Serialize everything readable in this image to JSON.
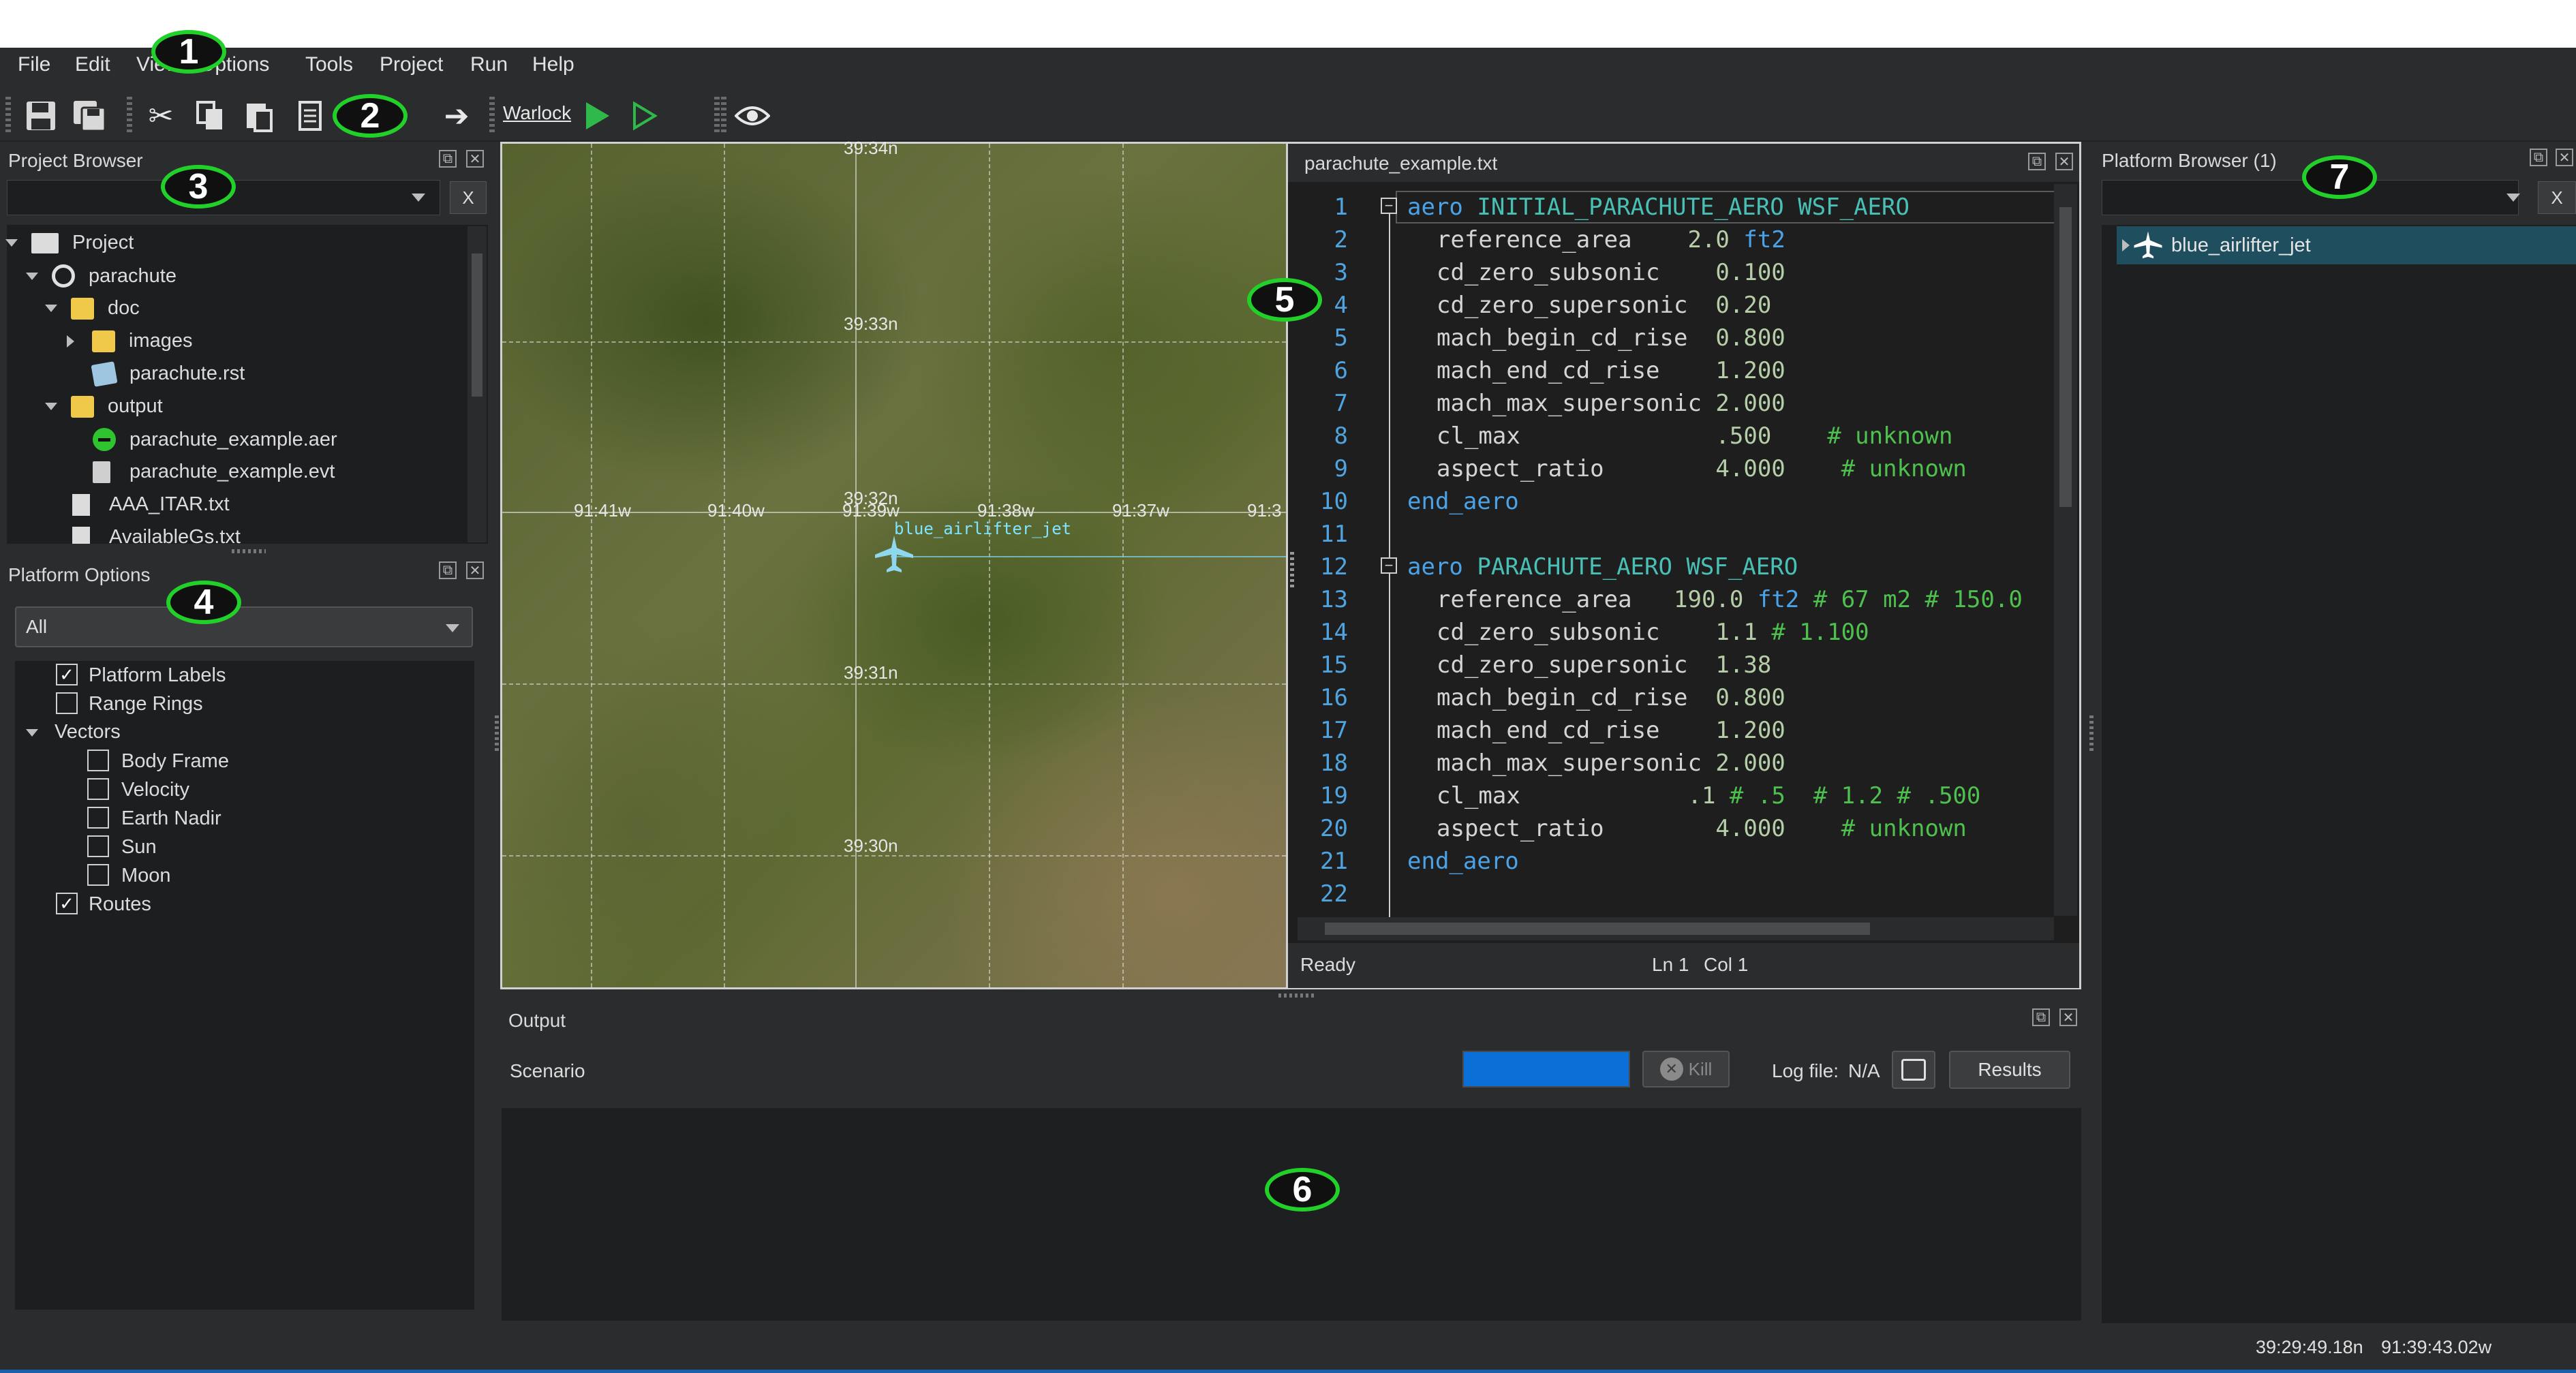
{
  "menu": [
    "File",
    "Edit",
    "View",
    "Options",
    "Tools",
    "Project",
    "Run",
    "Help"
  ],
  "toolbar": {
    "warlock_label": "Warlock",
    "icons": [
      "save-icon",
      "save-all-icon",
      "cut-icon",
      "copy-icon",
      "paste-icon",
      "document-icon",
      "arrow-right-icon",
      "run-icon",
      "run-outline-icon",
      "eye-icon"
    ]
  },
  "project_browser": {
    "title": "Project Browser",
    "clear_label": "X",
    "tree": [
      "Project",
      "parachute",
      "doc",
      "images",
      "parachute.rst",
      "output",
      "parachute_example.aer",
      "parachute_example.evt",
      "AAA_ITAR.txt",
      "AvailableGs.txt"
    ]
  },
  "platform_options": {
    "title": "Platform Options",
    "filter_value": "All",
    "items": [
      {
        "label": "Platform Labels",
        "checked": true
      },
      {
        "label": "Range Rings",
        "checked": false
      },
      {
        "label": "Vectors",
        "group": true
      },
      {
        "label": "Body Frame",
        "checked": false
      },
      {
        "label": "Velocity",
        "checked": false
      },
      {
        "label": "Earth Nadir",
        "checked": false
      },
      {
        "label": "Sun",
        "checked": false
      },
      {
        "label": "Moon",
        "checked": false
      },
      {
        "label": "Routes",
        "checked": true
      }
    ]
  },
  "map": {
    "lat_labels": [
      "39:34n",
      "39:33n",
      "39:32n",
      "39:31n",
      "39:30n"
    ],
    "lon_labels": [
      "91:41w",
      "91:40w",
      "91:39w",
      "91:38w",
      "91:37w",
      "91:3"
    ],
    "platform_label": "blue_airlifter_jet"
  },
  "editor": {
    "filename": "parachute_example.txt",
    "line_numbers": [
      "1",
      "2",
      "3",
      "4",
      "5",
      "6",
      "7",
      "8",
      "9",
      "10",
      "11",
      "12",
      "13",
      "14",
      "15",
      "16",
      "17",
      "18",
      "19",
      "20",
      "21",
      "22"
    ],
    "status": "Ready",
    "ln": "Ln 1",
    "col": "Col 1",
    "code": {
      "l1": {
        "kw": "aero",
        "name": "INITIAL_PARACHUTE_AERO",
        "type": "WSF_AERO"
      },
      "l2": {
        "key": "reference_area    ",
        "val": "2.0",
        "unit": "ft2"
      },
      "l3": {
        "key": "cd_zero_subsonic    ",
        "val": "0.100"
      },
      "l4": {
        "key": "cd_zero_supersonic  ",
        "val": "0.20"
      },
      "l5": {
        "key": "mach_begin_cd_rise  ",
        "val": "0.800"
      },
      "l6": {
        "key": "mach_end_cd_rise    ",
        "val": "1.200"
      },
      "l7": {
        "key": "mach_max_supersonic ",
        "val": "2.000"
      },
      "l8": {
        "key": "cl_max              ",
        "val": ".500",
        "comment": "# unknown"
      },
      "l9": {
        "key": "aspect_ratio        ",
        "val": "4.000",
        "comment": "# unknown"
      },
      "l10": "end_aero",
      "l12": {
        "kw": "aero",
        "name": "PARACHUTE_AERO",
        "type": "WSF_AERO"
      },
      "l13": {
        "key": "reference_area   ",
        "val": "190.0",
        "unit": "ft2",
        "comment": "# 67 m2 # 150.0"
      },
      "l14": {
        "key": "cd_zero_subsonic    ",
        "val": "1.1",
        "comment": "# 1.100"
      },
      "l15": {
        "key": "cd_zero_supersonic  ",
        "val": "1.38"
      },
      "l16": {
        "key": "mach_begin_cd_rise  ",
        "val": "0.800"
      },
      "l17": {
        "key": "mach_end_cd_rise    ",
        "val": "1.200"
      },
      "l18": {
        "key": "mach_max_supersonic ",
        "val": "2.000"
      },
      "l19": {
        "key": "cl_max            ",
        "val": ".1",
        "comment": "# .5  # 1.2 # .500"
      },
      "l20": {
        "key": "aspect_ratio        ",
        "val": "4.000",
        "comment": "# unknown"
      },
      "l21": "end_aero"
    }
  },
  "output": {
    "title": "Output",
    "scenario_label": "Scenario",
    "kill_label": "Kill",
    "log_file_label": "Log file:",
    "log_file_value": "N/A",
    "results_label": "Results"
  },
  "platform_browser": {
    "title": "Platform Browser (1)",
    "clear_label": "X",
    "items": [
      "blue_airlifter_jet"
    ]
  },
  "status_bar": {
    "lat": "39:29:49.18n",
    "lon": "91:39:43.02w"
  },
  "callouts": [
    "1",
    "2",
    "3",
    "4",
    "5",
    "6",
    "7"
  ],
  "colors": {
    "accent_blue": "#0a6fd6",
    "callout_green": "#22d02a",
    "selection": "#1f4e5e"
  }
}
